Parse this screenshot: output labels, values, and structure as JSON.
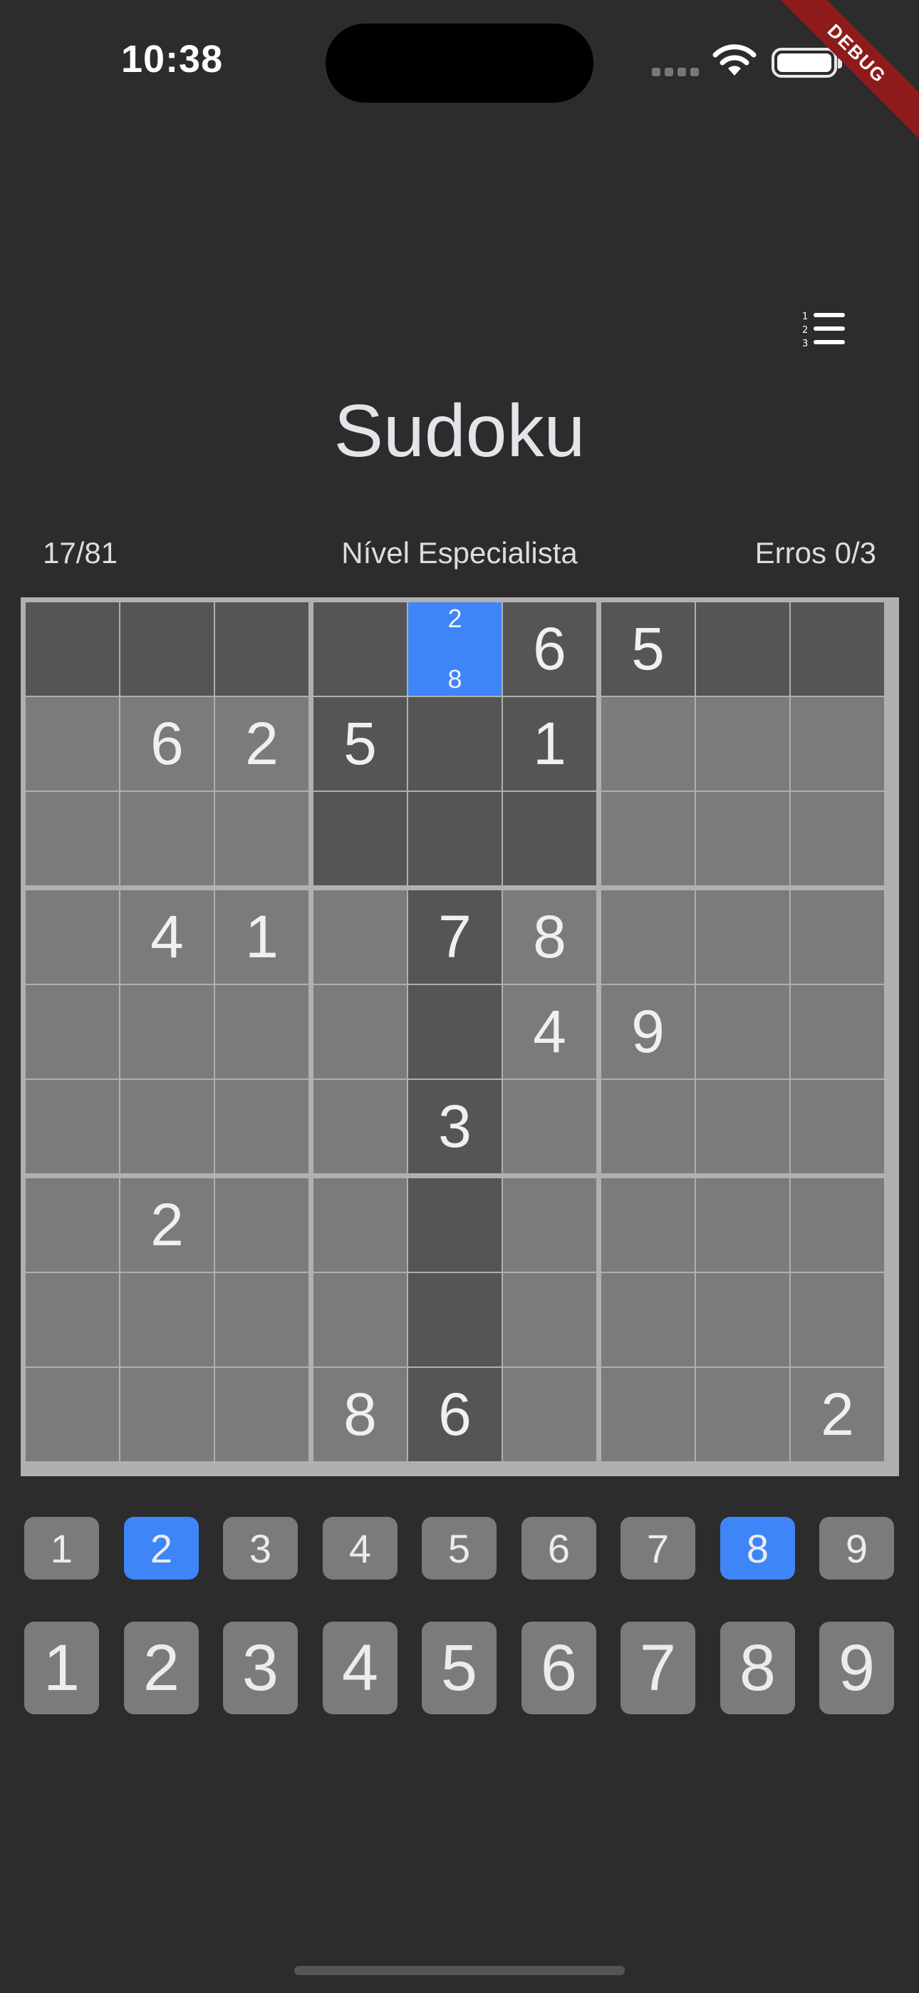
{
  "status": {
    "time": "10:38"
  },
  "debug_label": "DEBUG",
  "title": "Sudoku",
  "info": {
    "progress": "17/81",
    "level": "Nível Especialista",
    "errors": "Erros 0/3"
  },
  "colors": {
    "background": "#2c2c2c",
    "cell_light": "#7b7b7b",
    "cell_dark": "#555555",
    "selected": "#3e86f7",
    "grid_line": "#b0b0b0"
  },
  "board": {
    "values": [
      [
        "",
        "",
        "",
        "",
        "",
        "6",
        "5",
        "",
        ""
      ],
      [
        "",
        "6",
        "2",
        "5",
        "",
        "1",
        "",
        "",
        ""
      ],
      [
        "",
        "",
        "",
        "",
        "",
        "",
        "",
        "",
        ""
      ],
      [
        "",
        "4",
        "1",
        "",
        "7",
        "8",
        "",
        "",
        ""
      ],
      [
        "",
        "",
        "",
        "",
        "",
        "4",
        "9",
        "",
        ""
      ],
      [
        "",
        "",
        "",
        "",
        "3",
        "",
        "",
        "",
        ""
      ],
      [
        "",
        "2",
        "",
        "",
        "",
        "",
        "",
        "",
        ""
      ],
      [
        "",
        "",
        "",
        "",
        "",
        "",
        "",
        "",
        ""
      ],
      [
        "",
        "",
        "",
        "8",
        "6",
        "",
        "",
        "",
        "2"
      ]
    ],
    "selected": [
      0,
      4
    ],
    "selected_notes": [
      "2",
      "8"
    ]
  },
  "notes_buttons": [
    {
      "label": "1",
      "active": false
    },
    {
      "label": "2",
      "active": true
    },
    {
      "label": "3",
      "active": false
    },
    {
      "label": "4",
      "active": false
    },
    {
      "label": "5",
      "active": false
    },
    {
      "label": "6",
      "active": false
    },
    {
      "label": "7",
      "active": false
    },
    {
      "label": "8",
      "active": true
    },
    {
      "label": "9",
      "active": false
    }
  ],
  "number_buttons": [
    "1",
    "2",
    "3",
    "4",
    "5",
    "6",
    "7",
    "8",
    "9"
  ]
}
